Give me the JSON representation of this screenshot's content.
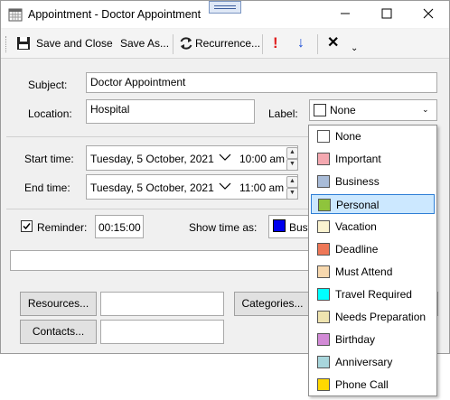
{
  "window": {
    "title": "Appointment - Doctor Appointment"
  },
  "toolbar": {
    "save_close": "Save and Close",
    "save_as": "Save As...",
    "recurrence": "Recurrence...",
    "importance_high": "!",
    "importance_low": "↓",
    "delete": "✕",
    "overflow": "⌄"
  },
  "form": {
    "subject_label": "Subject:",
    "subject_value": "Doctor Appointment",
    "location_label": "Location:",
    "location_value": "Hospital",
    "label_label": "Label:",
    "label_value": "None",
    "start_label": "Start time:",
    "start_date": "Tuesday, 5 October, 2021",
    "start_time": "10:00 am",
    "end_label": "End time:",
    "end_date": "Tuesday, 5 October, 2021",
    "end_time": "11:00 am",
    "reminder_label": "Reminder:",
    "reminder_checked": true,
    "reminder_value": "00:15:00",
    "show_time_label": "Show time as:",
    "show_time_value": "Busy",
    "show_time_color": "#0000ee",
    "resources_button": "Resources...",
    "contacts_button": "Contacts...",
    "categories_button": "Categories..."
  },
  "label_options": [
    {
      "label": "None",
      "color": "#ffffff"
    },
    {
      "label": "Important",
      "color": "#f4a8b0"
    },
    {
      "label": "Business",
      "color": "#a9bcd8"
    },
    {
      "label": "Personal",
      "color": "#8fc43c",
      "selected": true
    },
    {
      "label": "Vacation",
      "color": "#fbf3d0"
    },
    {
      "label": "Deadline",
      "color": "#ee7757"
    },
    {
      "label": "Must Attend",
      "color": "#f7d8ae"
    },
    {
      "label": "Travel Required",
      "color": "#00ffff"
    },
    {
      "label": "Needs Preparation",
      "color": "#efe4b0"
    },
    {
      "label": "Birthday",
      "color": "#d28ad6"
    },
    {
      "label": "Anniversary",
      "color": "#a8d6dc"
    },
    {
      "label": "Phone Call",
      "color": "#ffd800"
    }
  ]
}
